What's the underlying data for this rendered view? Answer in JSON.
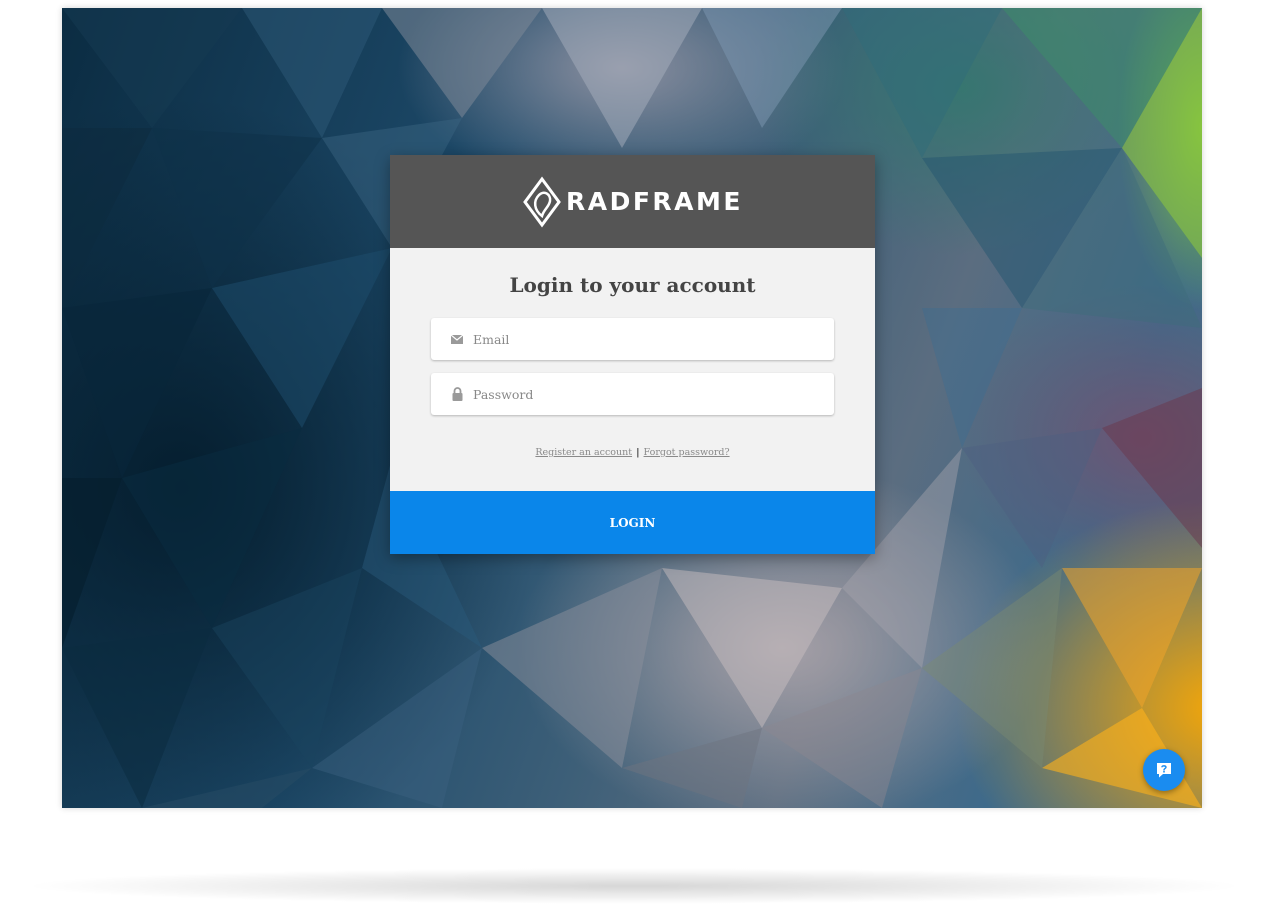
{
  "brand": {
    "name": "RADFRAME",
    "logo_icon": "diamond-leaf-logo"
  },
  "login_form": {
    "title": "Login to your account",
    "email_placeholder": "Email",
    "email_icon": "envelope-icon",
    "password_placeholder": "Password",
    "password_icon": "lock-icon",
    "register_link": "Register an account",
    "separator": "|",
    "forgot_link": "Forgot password?",
    "submit_label": "LOGIN"
  },
  "help_widget": {
    "icon": "help-chat-icon"
  },
  "colors": {
    "header_bg": "#555555",
    "body_bg": "#f2f2f2",
    "accent": "#0a86ea",
    "help_button": "#1a8cf0"
  }
}
